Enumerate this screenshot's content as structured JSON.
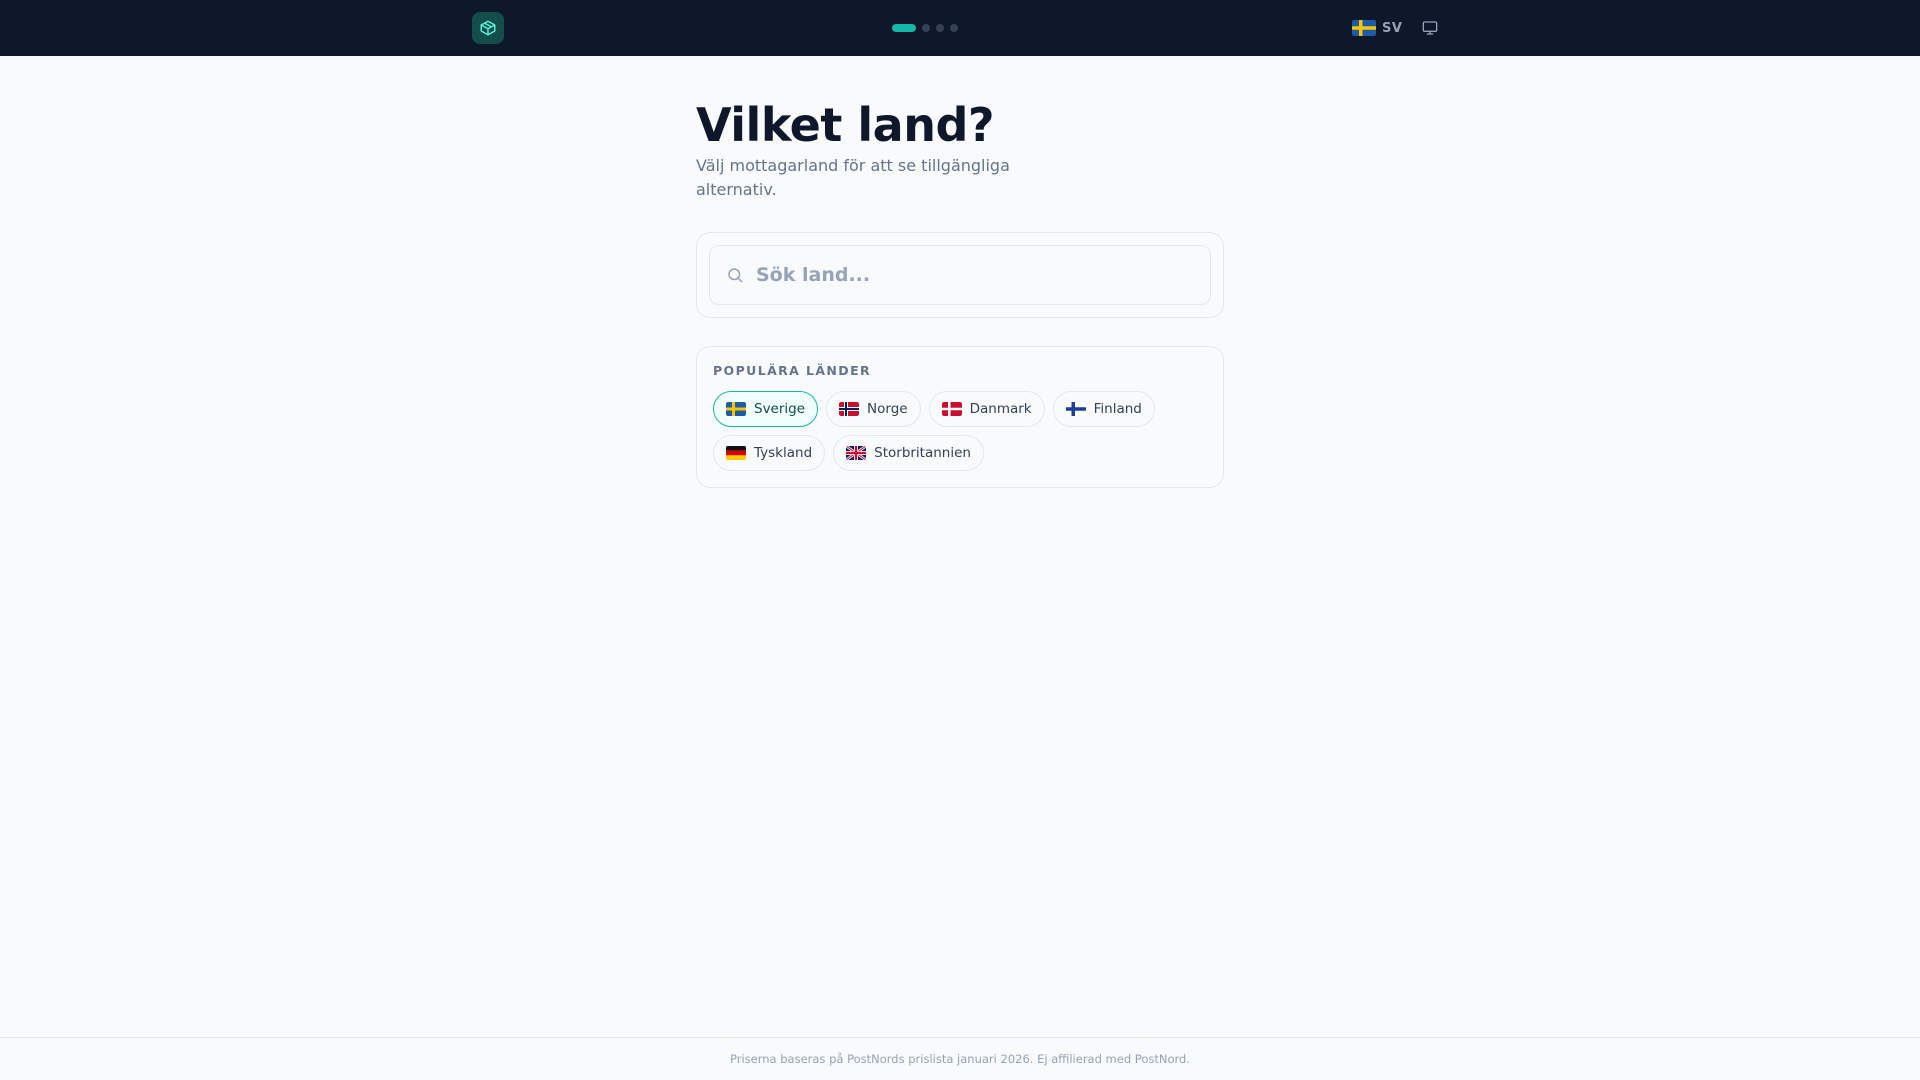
{
  "header": {
    "logo_icon": "package-icon",
    "steps": {
      "total": 4,
      "current": 1
    },
    "language": {
      "flag": "flag-se",
      "code": "SV"
    },
    "display_icon": "monitor-icon"
  },
  "main": {
    "title": "Vilket land?",
    "subtitle": "Välj mottagarland för att se tillgängliga alternativ.",
    "search": {
      "placeholder": "Sök land...",
      "value": "",
      "icon": "search-icon"
    },
    "popular": {
      "heading": "POPULÄRA LÄNDER",
      "countries": [
        {
          "label": "Sverige",
          "flag": "flag-se",
          "selected": true
        },
        {
          "label": "Norge",
          "flag": "flag-no",
          "selected": false
        },
        {
          "label": "Danmark",
          "flag": "flag-dk",
          "selected": false
        },
        {
          "label": "Finland",
          "flag": "flag-fi",
          "selected": false
        },
        {
          "label": "Tyskland",
          "flag": "flag-de",
          "selected": false
        },
        {
          "label": "Storbritannien",
          "flag": "flag-gb",
          "selected": false
        }
      ]
    }
  },
  "footer": {
    "text": "Priserna baseras på PostNords prislista januari 2026. Ej affilierad med PostNord."
  },
  "colors": {
    "accent": "#14b8a6",
    "header_bg": "#0f172a",
    "page_bg": "#f8fafc"
  }
}
